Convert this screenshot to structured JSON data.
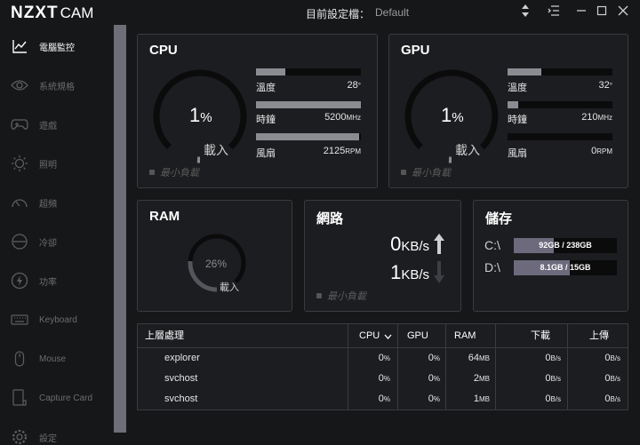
{
  "app": {
    "logo": "NZXT",
    "logo_suffix": "CAM"
  },
  "header": {
    "profile_label": "目前設定檔：",
    "profile_value": "Default"
  },
  "sidebar": {
    "items": [
      {
        "label": "電腦監控",
        "icon": "monitoring-chart-icon"
      },
      {
        "label": "系統規格",
        "icon": "eye-icon"
      },
      {
        "label": "遊戲",
        "icon": "gamepad-icon"
      },
      {
        "label": "照明",
        "icon": "sun-icon"
      },
      {
        "label": "超頻",
        "icon": "speedometer-icon"
      },
      {
        "label": "冷卻",
        "icon": "fan-icon"
      },
      {
        "label": "功率",
        "icon": "lightning-icon"
      },
      {
        "label": "Keyboard",
        "icon": "keyboard-icon"
      },
      {
        "label": "Mouse",
        "icon": "mouse-icon"
      },
      {
        "label": "Capture Card",
        "icon": "capture-card-icon"
      },
      {
        "label": "設定",
        "icon": "gear-icon"
      }
    ]
  },
  "cpu": {
    "title": "CPU",
    "load_value": "1",
    "load_unit": "%",
    "load_label": "載入",
    "load_fraction": 0.01,
    "min_load": "最小負載",
    "temp_label": "溫度",
    "temp_value": "28",
    "temp_unit": "°",
    "temp_fraction": 0.28,
    "clock_label": "時鐘",
    "clock_value": "5200",
    "clock_unit": "MHz",
    "clock_fraction": 1.0,
    "fan_label": "風扇",
    "fan_value": "2125",
    "fan_unit": "RPM",
    "fan_fraction": 0.98
  },
  "gpu": {
    "title": "GPU",
    "load_value": "1",
    "load_unit": "%",
    "load_label": "載入",
    "load_fraction": 0.01,
    "min_load": "最小負載",
    "temp_label": "溫度",
    "temp_value": "32",
    "temp_unit": "°",
    "temp_fraction": 0.32,
    "clock_label": "時鐘",
    "clock_value": "210",
    "clock_unit": "MHz",
    "clock_fraction": 0.1,
    "fan_label": "風扇",
    "fan_value": "0",
    "fan_unit": "RPM",
    "fan_fraction": 0.0
  },
  "ram": {
    "title": "RAM",
    "load_value": "26",
    "load_unit": "%",
    "load_label": "載入",
    "load_fraction": 0.26
  },
  "network": {
    "title": "網路",
    "download_value": "0",
    "download_unit": "KB/s",
    "upload_value": "1",
    "upload_unit": "KB/s",
    "min_load": "最小負載"
  },
  "storage": {
    "title": "儲存",
    "drives": [
      {
        "label": "C:\\",
        "text": "92GB / 238GB",
        "fraction": 0.387
      },
      {
        "label": "D:\\",
        "text": "8.1GB / 15GB",
        "fraction": 0.54
      }
    ]
  },
  "processes": {
    "headers": {
      "name": "上層處理",
      "cpu": "CPU",
      "gpu": "GPU",
      "ram": "RAM",
      "down": "下載",
      "up": "上傳"
    },
    "rows": [
      {
        "name": "explorer",
        "cpu": "0",
        "gpu": "0",
        "ram": "64",
        "ram_unit": "MB",
        "down": "0",
        "down_unit": "B/s",
        "up": "0",
        "up_unit": "B/s"
      },
      {
        "name": "svchost",
        "cpu": "0",
        "gpu": "0",
        "ram": "2",
        "ram_unit": "MB",
        "down": "0",
        "down_unit": "B/s",
        "up": "0",
        "up_unit": "B/s"
      },
      {
        "name": "svchost",
        "cpu": "0",
        "gpu": "0",
        "ram": "1",
        "ram_unit": "MB",
        "down": "0",
        "down_unit": "B/s",
        "up": "0",
        "up_unit": "B/s"
      }
    ],
    "pct_unit": "%"
  },
  "colors": {
    "accent_bar": "#8b8b92",
    "drive_fill": "#6c6a7c",
    "card_border": "#3a3b3f"
  }
}
